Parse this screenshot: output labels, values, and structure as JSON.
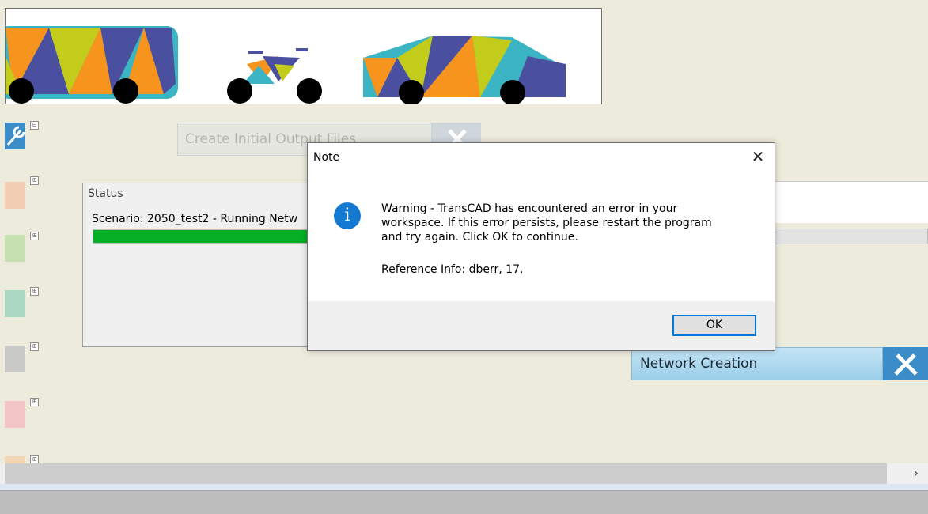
{
  "colors": {
    "orange": "#f7941d",
    "navy": "#4b4f9f",
    "teal": "#3bb5c3",
    "lime": "#c3cb1b",
    "progress_green": "#06b025",
    "accent_blue": "#0078d7",
    "info_blue": "#1479d1"
  },
  "steps": {
    "output_label": "Create Initial Output Files",
    "network_label": "Network Creation",
    "output_icon": "wrench-screwdriver-icon",
    "network_icon": "wrench-screwdriver-icon"
  },
  "tree": {
    "expanded_toggle": "⊟",
    "collapsed_toggle": "⊞",
    "icons": [
      "tools-icon",
      "building-icon",
      "person-icon",
      "clock-icon",
      "arrow-icon",
      "bus-icon",
      "truck-icon"
    ]
  },
  "status": {
    "title": "Status",
    "text": "Scenario: 2050_test2 - Running Netw",
    "progress": 0.98
  },
  "dialog": {
    "title": "Note",
    "close_glyph": "✕",
    "icon": "info-icon",
    "icon_glyph": "i",
    "message": "Warning - TransCAD has encountered an error in your\nworkspace.  If this error persists, please restart the program\nand try again.  Click OK to continue.",
    "reference": "Reference Info: dberr, 17.",
    "ok_label": "OK"
  },
  "scrollbar": {
    "right_arrow": "›"
  }
}
